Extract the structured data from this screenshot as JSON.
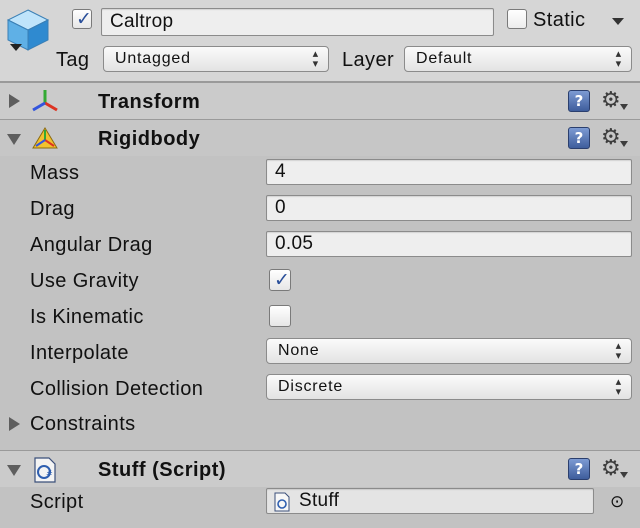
{
  "header": {
    "object_name": "Caltrop",
    "active": true,
    "static_label": "Static",
    "static_checked": false,
    "tag_label": "Tag",
    "tag_value": "Untagged",
    "layer_label": "Layer",
    "layer_value": "Default"
  },
  "transform": {
    "title": "Transform",
    "expanded": false
  },
  "rigidbody": {
    "title": "Rigidbody",
    "expanded": true,
    "mass_label": "Mass",
    "mass_value": "4",
    "drag_label": "Drag",
    "drag_value": "0",
    "angular_drag_label": "Angular Drag",
    "angular_drag_value": "0.05",
    "use_gravity_label": "Use Gravity",
    "use_gravity": true,
    "is_kinematic_label": "Is Kinematic",
    "is_kinematic": false,
    "interpolate_label": "Interpolate",
    "interpolate_value": "None",
    "collision_label": "Collision Detection",
    "collision_value": "Discrete",
    "constraints_label": "Constraints"
  },
  "script_component": {
    "title": "Stuff (Script)",
    "active": true,
    "script_label": "Script",
    "script_value": "Stuff"
  },
  "icons": {
    "help": "help-book-icon",
    "settings": "gear-icon",
    "object": "cube-icon",
    "transform": "transform-axes-icon",
    "rigidbody": "rigidbody-icon",
    "script": "csharp-script-icon",
    "object_picker": "target-circle-icon"
  },
  "glyphs": {
    "check": "✓",
    "help": "?",
    "gear": "⚙",
    "popup_arrows": "▴▾",
    "script_file": "C#",
    "picker": "⊙"
  },
  "colors": {
    "checkmark": "#2a4f9a",
    "help_icon": "#3e5d9c",
    "inspector_bg": "#c2c2c2"
  }
}
